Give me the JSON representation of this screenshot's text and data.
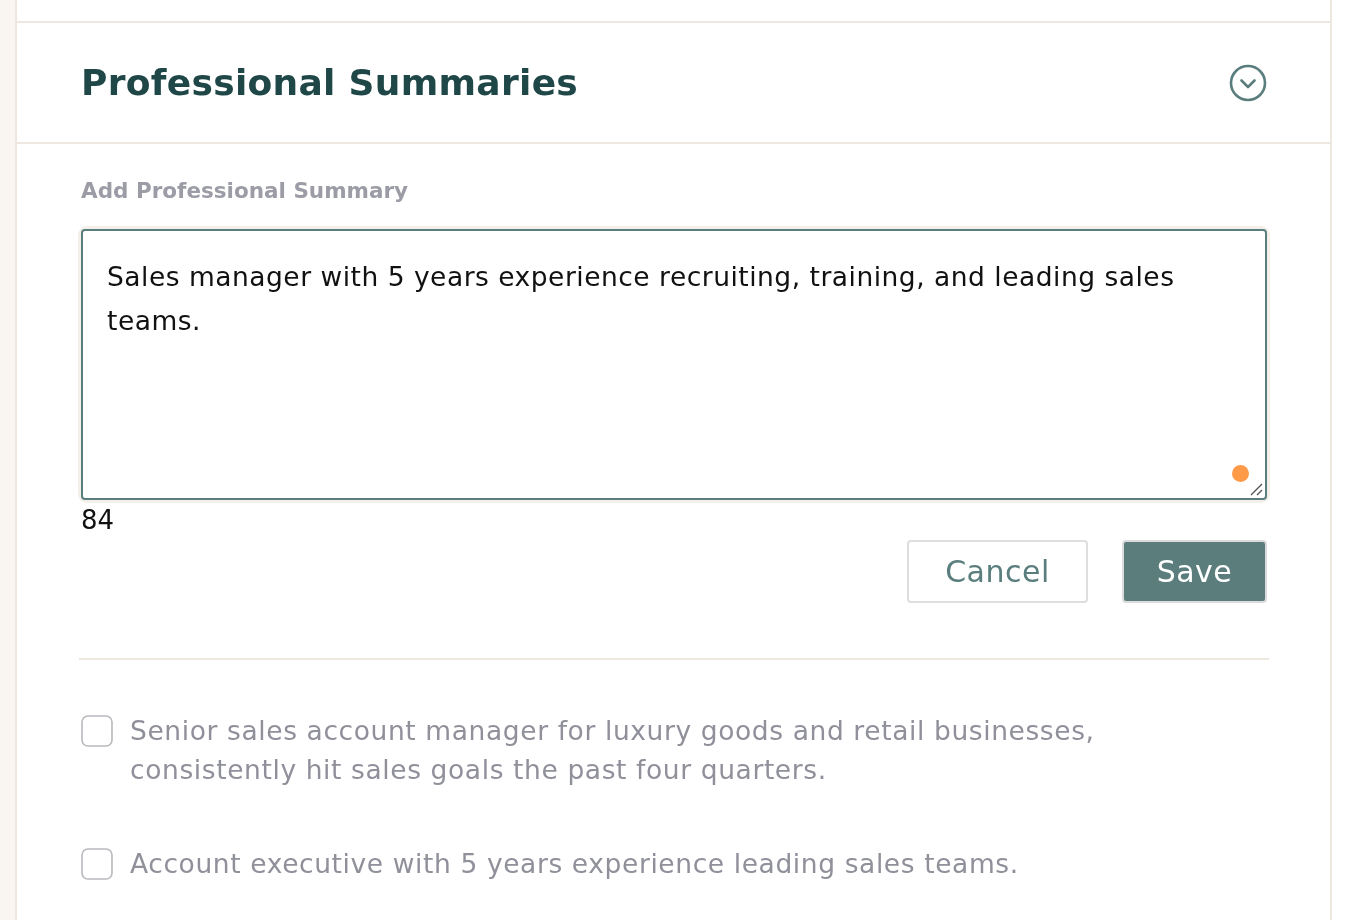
{
  "header": {
    "title": "Professional Summaries",
    "expanded": true
  },
  "editor": {
    "label": "Add Professional Summary",
    "value": "Sales manager with 5 years experience recruiting, training, and leading sales teams.",
    "count": "84"
  },
  "buttons": [
    {
      "label": "Cancel",
      "kind": "secondary"
    },
    {
      "label": "Save",
      "kind": "primary"
    }
  ],
  "suggestions": [
    {
      "text": "Senior sales account manager for luxury goods and retail businesses, consistently hit sales goals the past four quarters.",
      "checked": false
    },
    {
      "text": "Account executive with 5 years experience leading sales teams.",
      "checked": false
    }
  ]
}
